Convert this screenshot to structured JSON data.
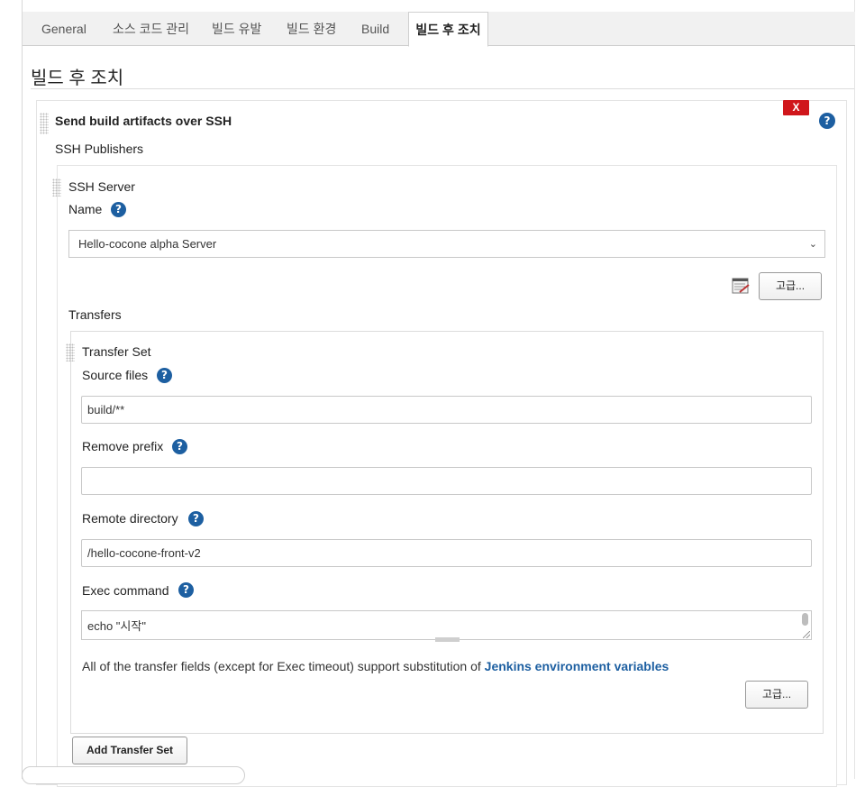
{
  "tabs": [
    {
      "label": "General"
    },
    {
      "label": "소스 코드 관리"
    },
    {
      "label": "빌드 유발"
    },
    {
      "label": "빌드 환경"
    },
    {
      "label": "Build"
    },
    {
      "label": "빌드 후 조치"
    }
  ],
  "active_tab_index": 5,
  "section": {
    "title": "빌드 후 조치"
  },
  "publisher": {
    "title": "Send build artifacts over SSH",
    "close_label": "X",
    "help_icon": "?",
    "subtitle": "SSH Publishers"
  },
  "server": {
    "title": "SSH Server",
    "name_label": "Name",
    "name_value": "Hello-cocone alpha Server",
    "advanced_label": "고급..."
  },
  "transfers": {
    "label": "Transfers",
    "set_title": "Transfer Set",
    "source_files_label": "Source files",
    "source_files_value": "build/**",
    "remove_prefix_label": "Remove prefix",
    "remove_prefix_value": "",
    "remote_directory_label": "Remote directory",
    "remote_directory_value": "/hello-cocone-front-v2",
    "exec_command_label": "Exec command",
    "exec_command_value": "echo \"시작\"",
    "note_text": "All of the transfer fields (except for Exec timeout) support substitution of ",
    "note_link": "Jenkins environment variables",
    "advanced_label": "고급...",
    "add_button_label": "Add Transfer Set"
  },
  "colors": {
    "help_blue": "#1d5fa1",
    "close_red": "#d0161b",
    "link_blue": "#1d5fa1"
  }
}
